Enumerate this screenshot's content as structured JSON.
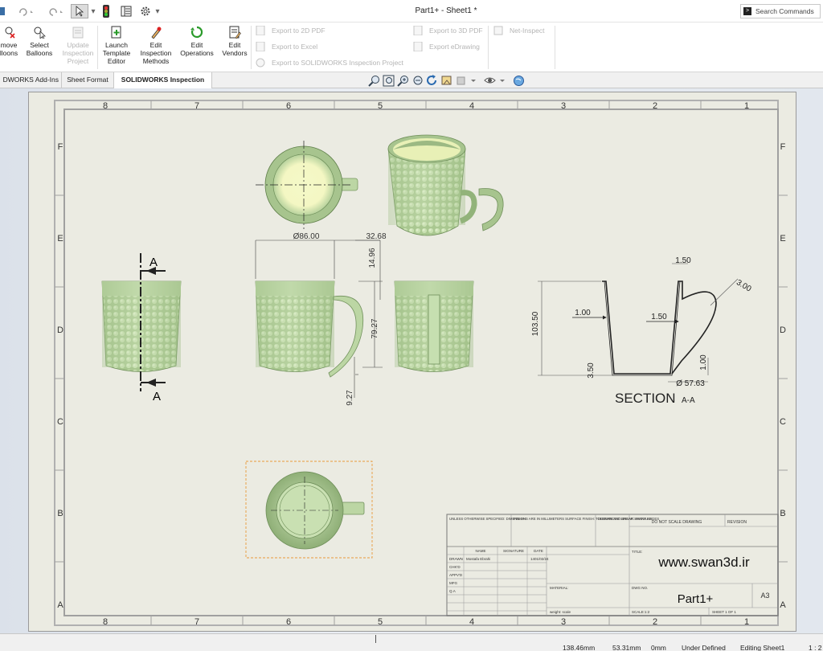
{
  "window": {
    "title": "Part1+ - Sheet1 *"
  },
  "search": {
    "label": "Search Commands"
  },
  "ribbon": {
    "buttons": [
      {
        "l1": "move",
        "l2": "lloons",
        "l3": ""
      },
      {
        "l1": "Select",
        "l2": "Balloons",
        "l3": ""
      },
      {
        "l1": "Update",
        "l2": "Inspection",
        "l3": "Project"
      },
      {
        "l1": "Launch",
        "l2": "Template",
        "l3": "Editor"
      },
      {
        "l1": "Edit",
        "l2": "Inspection",
        "l3": "Methods"
      },
      {
        "l1": "Edit",
        "l2": "Operations",
        "l3": ""
      },
      {
        "l1": "Edit",
        "l2": "Vendors",
        "l3": ""
      }
    ],
    "exports": {
      "pdf2d": "Export to 2D PDF",
      "excel": "Export to Excel",
      "project": "Export to SOLIDWORKS Inspection Project",
      "pdf3d": "Export to 3D PDF",
      "edrawing": "Export eDrawing",
      "netinspect": "Net-Inspect"
    }
  },
  "tabs": [
    "DWORKS Add-Ins",
    "Sheet Format",
    "SOLIDWORKS Inspection"
  ],
  "status": {
    "x": "138.46mm",
    "y": "53.31mm",
    "z": "0mm",
    "state": "Under Defined",
    "mode": "Editing Sheet1",
    "scale": "1 : 2"
  },
  "drawing": {
    "zone_cols": [
      "8",
      "7",
      "6",
      "5",
      "4",
      "3",
      "2",
      "1"
    ],
    "zone_rows": [
      "F",
      "E",
      "D",
      "C",
      "B",
      "A"
    ],
    "dims": {
      "dia86": "Ø86.00",
      "w3268": "32.68",
      "h1496": "14.96",
      "h7927": "79.27",
      "h927": "9.27",
      "sec150top": "1.50",
      "sec300": "3.00",
      "sec100l": "1.00",
      "sec150m": "1.50",
      "sec10350": "103.50",
      "sec350": "3.50",
      "dia5763": "Ø 57.63",
      "sec100r": "1.00"
    },
    "section_marker": "A",
    "section_title": "SECTION",
    "section_sub": "A-A",
    "title_block": {
      "tolerance_notes": "UNLESS OTHERWISE SPECIFIED: DIMENSIONS ARE IN MILLIMETERS SURFACE FINISH: TOLERANCES: LINEAR: ANGULAR:",
      "finish": "FINISH:",
      "deburr": "DEBURR AND BREAK SHARP EDGES",
      "do_not_scale": "DO NOT SCALE DRAWING",
      "revision": "REVISION",
      "col_name": "NAME",
      "col_signature": "SIGNATURE",
      "col_date": "DATE",
      "drawn_label": "DRAWN",
      "drawn_name": "Mostafa Ebrahi",
      "drawn_date": "1401/02/24",
      "rows": [
        "CHK'D",
        "APPV'D",
        "MFG",
        "Q.A"
      ],
      "title_label": "TITLE:",
      "title_text": "www.swan3d.ir",
      "material": "MATERIAL:",
      "dwg_no_label": "DWG NO.",
      "dwg_no": "Part1+",
      "size": "A3",
      "weight": "weight: scale",
      "scale": "SCALE:1:2",
      "sheet": "SHEET 1 OF 1"
    }
  },
  "colors": {
    "mug": "#bcd6a4",
    "sheet": "#ebebe2",
    "frame": "#a8a8a8"
  }
}
